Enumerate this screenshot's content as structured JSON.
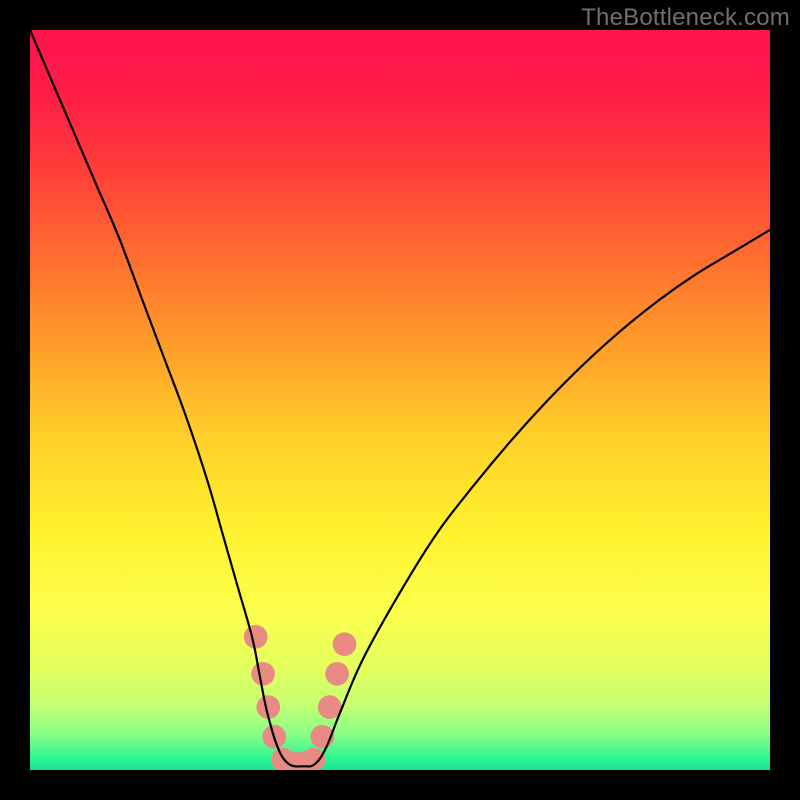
{
  "watermark": "TheBottleneck.com",
  "gradient_stops": [
    {
      "offset": 0.0,
      "color": "#ff144d"
    },
    {
      "offset": 0.08,
      "color": "#ff1b47"
    },
    {
      "offset": 0.18,
      "color": "#ff3a3a"
    },
    {
      "offset": 0.3,
      "color": "#ff6a2f"
    },
    {
      "offset": 0.42,
      "color": "#ff9a2a"
    },
    {
      "offset": 0.55,
      "color": "#ffd029"
    },
    {
      "offset": 0.68,
      "color": "#fff22f"
    },
    {
      "offset": 0.78,
      "color": "#fcff4a"
    },
    {
      "offset": 0.86,
      "color": "#e4ff5e"
    },
    {
      "offset": 0.91,
      "color": "#c6ff70"
    },
    {
      "offset": 0.95,
      "color": "#8cff86"
    },
    {
      "offset": 0.985,
      "color": "#2cf592"
    },
    {
      "offset": 1.0,
      "color": "#18e08f"
    }
  ],
  "chart_data": {
    "type": "line",
    "title": "",
    "xlabel": "",
    "ylabel": "",
    "xlim": [
      0,
      100
    ],
    "ylim": [
      0,
      100
    ],
    "grid": false,
    "legend": false,
    "note": "Values read off pixel positions; y is approximate % height (higher = worse on the red side, valley near zero = optimal).",
    "series": [
      {
        "name": "bottleneck-curve",
        "x": [
          0,
          3,
          6,
          9,
          12,
          15,
          18,
          21,
          24,
          26,
          28,
          30,
          31,
          32,
          33.5,
          35,
          37,
          38.5,
          40,
          42,
          45,
          50,
          55,
          60,
          65,
          70,
          75,
          80,
          85,
          90,
          95,
          100
        ],
        "y": [
          100,
          93,
          86,
          79,
          72,
          64,
          56,
          48,
          39,
          32,
          25,
          18,
          13,
          8,
          3,
          0.8,
          0.5,
          0.8,
          3,
          8,
          15,
          24,
          32,
          38.5,
          44.5,
          50,
          55,
          59.5,
          63.5,
          67,
          70,
          73
        ]
      }
    ],
    "markers": [
      {
        "name": "left-upper-bead",
        "x": 30.5,
        "y": 18,
        "r": 1.6
      },
      {
        "name": "left-mid-bead",
        "x": 31.5,
        "y": 13,
        "r": 1.6
      },
      {
        "name": "left-low-bead-1",
        "x": 32.2,
        "y": 8.5,
        "r": 1.6
      },
      {
        "name": "left-low-bead-2",
        "x": 33.0,
        "y": 4.5,
        "r": 1.6
      },
      {
        "name": "valley-bead-1",
        "x": 34.2,
        "y": 1.4,
        "r": 1.6
      },
      {
        "name": "valley-bead-2",
        "x": 35.5,
        "y": 0.9,
        "r": 1.6
      },
      {
        "name": "valley-bead-3",
        "x": 37.0,
        "y": 0.9,
        "r": 1.6
      },
      {
        "name": "valley-bead-4",
        "x": 38.3,
        "y": 1.4,
        "r": 1.6
      },
      {
        "name": "right-low-bead-1",
        "x": 39.5,
        "y": 4.5,
        "r": 1.6
      },
      {
        "name": "right-low-bead-2",
        "x": 40.5,
        "y": 8.5,
        "r": 1.6
      },
      {
        "name": "right-mid-bead",
        "x": 41.5,
        "y": 13,
        "r": 1.6
      },
      {
        "name": "right-upper-bead",
        "x": 42.5,
        "y": 17,
        "r": 1.6
      }
    ],
    "marker_color": "#e98b84"
  }
}
